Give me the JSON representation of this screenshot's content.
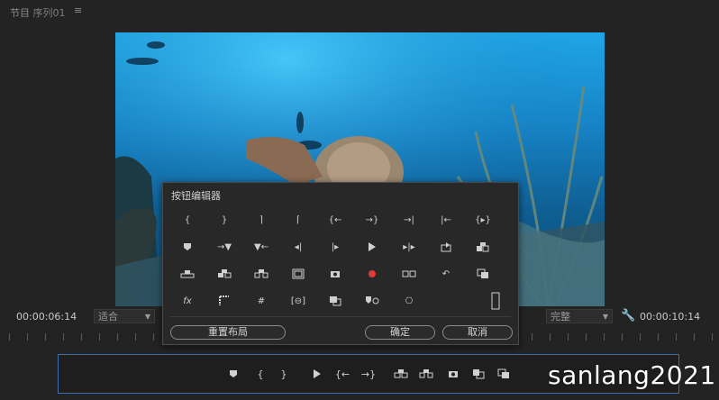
{
  "panel": {
    "title": "节目: 序列01",
    "title_main": "节目",
    "title_seq": "序列01",
    "menu_icon": "hamburger-icon"
  },
  "video": {
    "content": "underwater-coral-reef-scene",
    "accent": "#1fa6e6"
  },
  "timecode": {
    "current": "00:00:06:14",
    "duration": "00:00:10:14"
  },
  "fit": {
    "value": "适合"
  },
  "quality": {
    "value": "完整"
  },
  "dialog": {
    "title": "按钮编辑器",
    "rows": [
      [
        "mark-in",
        "mark-out",
        "mark-clip-in",
        "mark-clip-out",
        "go-to-in",
        "go-to-out",
        "go-to-next-edit-out",
        "go-to-prev-edit-in",
        "go-to-clip-in-out"
      ],
      [
        "add-marker",
        "go-to-next-marker",
        "go-to-prev-marker",
        "step-back",
        "step-forward",
        "play",
        "play-around",
        "export-frame",
        "overwrite-insert"
      ],
      [
        "lift",
        "extract",
        "insert",
        "safe-margins",
        "camera",
        "record",
        "multi-camera",
        "loop",
        "compare"
      ],
      [
        "fx",
        "comparison-view",
        "toggle-proxies",
        "vr-video",
        "transmit",
        "proxy",
        "global-fx",
        "",
        "empty-slot"
      ]
    ],
    "reset_label": "重置布局",
    "ok_label": "确定",
    "cancel_label": "取消"
  },
  "button_bar": {
    "items": [
      "add-marker",
      "mark-in",
      "mark-out",
      "play",
      "go-to-in",
      "go-to-out",
      "lift",
      "extract",
      "camera",
      "overwrite",
      "compare"
    ]
  },
  "watermark": "sanlang2021"
}
